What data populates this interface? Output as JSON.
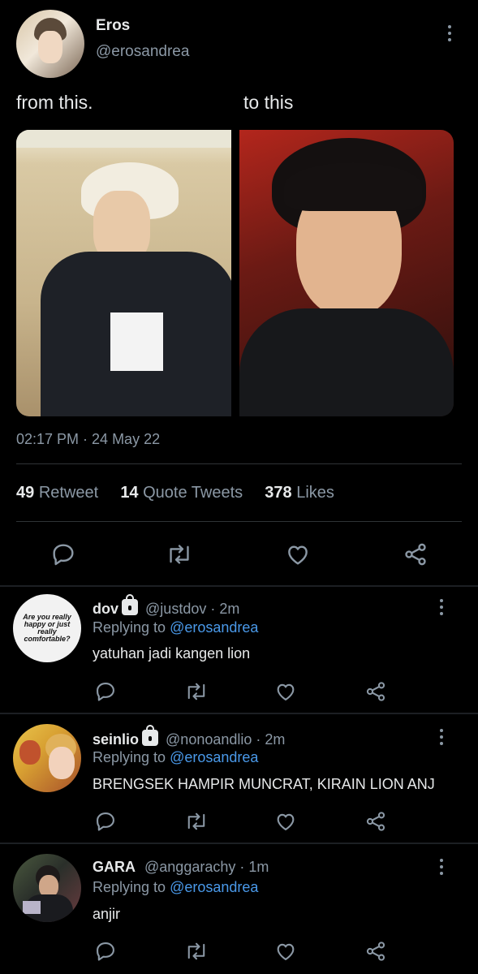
{
  "tweet": {
    "author_name": "Eros",
    "author_handle": "@erosandrea",
    "text_left": "from this.",
    "text_right": "to this",
    "timestamp": "02:17 PM · 24 May 22",
    "stats": {
      "retweets_count": "49",
      "retweets_label": "Retweet",
      "quotes_count": "14",
      "quotes_label": "Quote Tweets",
      "likes_count": "378",
      "likes_label": "Likes"
    }
  },
  "replies": [
    {
      "name": "dov",
      "handle_time": "@justdov · 2m",
      "replying_prefix": "Replying to",
      "replying_to": "@erosandrea",
      "text": "yatuhan jadi kangen lion",
      "avatar_text": "Are you really happy or just really comfortable?",
      "locked": true
    },
    {
      "name": "seinlio",
      "handle_time": "@nonoandlio · 2m",
      "replying_prefix": "Replying to",
      "replying_to": "@erosandrea",
      "text": "BRENGSEK HAMPIR MUNCRAT, KIRAIN LION ANJ",
      "locked": true
    },
    {
      "name": "GARA",
      "handle_time": "@anggarachy · 1m",
      "replying_prefix": "Replying to",
      "replying_to": "@erosandrea",
      "text": "anjir",
      "locked": false
    }
  ],
  "icons": {
    "reply": "reply-icon",
    "retweet": "retweet-icon",
    "like": "heart-icon",
    "share": "share-icon",
    "more": "more-icon",
    "lock": "lock-icon"
  },
  "colors": {
    "background": "#000000",
    "text": "#e7e9ea",
    "muted": "#8b98a5",
    "link": "#4a99e9"
  }
}
